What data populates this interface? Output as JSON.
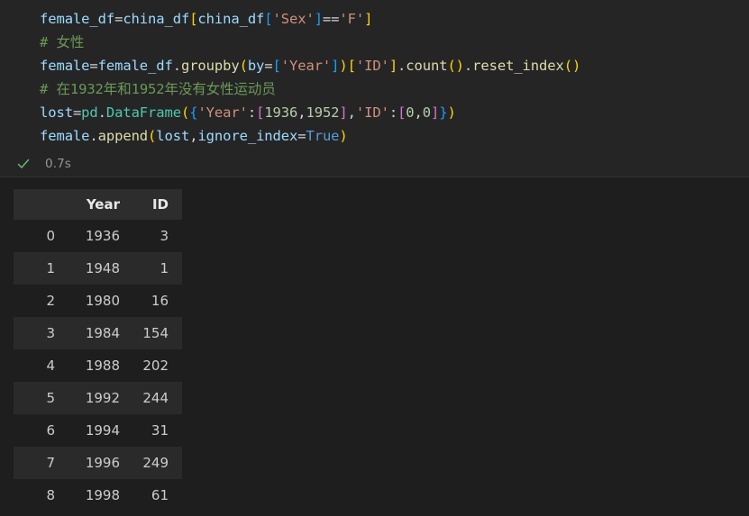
{
  "cell": {
    "status_icon": "check-icon",
    "status_accent": "#4EC9B0",
    "execution_time": "0.7s",
    "code_lines": [
      {
        "id": "line-1",
        "tokens": [
          {
            "t": "female_df",
            "c": "tok-var"
          },
          {
            "t": "=",
            "c": "tok-op"
          },
          {
            "t": "china_df",
            "c": "tok-var"
          },
          {
            "t": "[",
            "c": "tok-brk3"
          },
          {
            "t": "china_df",
            "c": "tok-var"
          },
          {
            "t": "[",
            "c": "tok-brk2"
          },
          {
            "t": "'Sex'",
            "c": "tok-str"
          },
          {
            "t": "]",
            "c": "tok-brk2"
          },
          {
            "t": "==",
            "c": "tok-op"
          },
          {
            "t": "'F'",
            "c": "tok-str"
          },
          {
            "t": "]",
            "c": "tok-brk3"
          }
        ]
      },
      {
        "id": "line-2",
        "tokens": [
          {
            "t": "# 女性",
            "c": "tok-cmt"
          }
        ]
      },
      {
        "id": "line-3",
        "tokens": [
          {
            "t": "female",
            "c": "tok-var"
          },
          {
            "t": "=",
            "c": "tok-op"
          },
          {
            "t": "female_df",
            "c": "tok-var"
          },
          {
            "t": ".",
            "c": "tok-punc"
          },
          {
            "t": "groupby",
            "c": "tok-fn"
          },
          {
            "t": "(",
            "c": "tok-brk3"
          },
          {
            "t": "by",
            "c": "tok-var"
          },
          {
            "t": "=",
            "c": "tok-op"
          },
          {
            "t": "[",
            "c": "tok-brk2"
          },
          {
            "t": "'Year'",
            "c": "tok-str"
          },
          {
            "t": "]",
            "c": "tok-brk2"
          },
          {
            "t": ")",
            "c": "tok-brk3"
          },
          {
            "t": "[",
            "c": "tok-brk3"
          },
          {
            "t": "'ID'",
            "c": "tok-str"
          },
          {
            "t": "]",
            "c": "tok-brk3"
          },
          {
            "t": ".",
            "c": "tok-punc"
          },
          {
            "t": "count",
            "c": "tok-fn"
          },
          {
            "t": "()",
            "c": "tok-brk3"
          },
          {
            "t": ".",
            "c": "tok-punc"
          },
          {
            "t": "reset_index",
            "c": "tok-fn"
          },
          {
            "t": "()",
            "c": "tok-brk3"
          }
        ]
      },
      {
        "id": "line-4",
        "tokens": [
          {
            "t": "# 在1932年和1952年没有女性运动员",
            "c": "tok-cmt"
          }
        ]
      },
      {
        "id": "line-5",
        "tokens": [
          {
            "t": "lost",
            "c": "tok-var"
          },
          {
            "t": "=",
            "c": "tok-op"
          },
          {
            "t": "pd",
            "c": "tok-cls"
          },
          {
            "t": ".",
            "c": "tok-punc"
          },
          {
            "t": "DataFrame",
            "c": "tok-cls"
          },
          {
            "t": "(",
            "c": "tok-brk3"
          },
          {
            "t": "{",
            "c": "tok-brk2"
          },
          {
            "t": "'Year'",
            "c": "tok-str"
          },
          {
            "t": ":",
            "c": "tok-punc"
          },
          {
            "t": "[",
            "c": "tok-brk"
          },
          {
            "t": "1936",
            "c": "tok-num"
          },
          {
            "t": ",",
            "c": "tok-punc"
          },
          {
            "t": "1952",
            "c": "tok-num"
          },
          {
            "t": "]",
            "c": "tok-brk"
          },
          {
            "t": ",",
            "c": "tok-punc"
          },
          {
            "t": "'ID'",
            "c": "tok-str"
          },
          {
            "t": ":",
            "c": "tok-punc"
          },
          {
            "t": "[",
            "c": "tok-brk"
          },
          {
            "t": "0",
            "c": "tok-num"
          },
          {
            "t": ",",
            "c": "tok-punc"
          },
          {
            "t": "0",
            "c": "tok-num"
          },
          {
            "t": "]",
            "c": "tok-brk"
          },
          {
            "t": "}",
            "c": "tok-brk2"
          },
          {
            "t": ")",
            "c": "tok-brk3"
          }
        ]
      },
      {
        "id": "line-6",
        "tokens": [
          {
            "t": "female",
            "c": "tok-var"
          },
          {
            "t": ".",
            "c": "tok-punc"
          },
          {
            "t": "append",
            "c": "tok-fn"
          },
          {
            "t": "(",
            "c": "tok-brk3"
          },
          {
            "t": "lost",
            "c": "tok-var"
          },
          {
            "t": ",",
            "c": "tok-punc"
          },
          {
            "t": "ignore_index",
            "c": "tok-var"
          },
          {
            "t": "=",
            "c": "tok-op"
          },
          {
            "t": "True",
            "c": "tok-kw"
          },
          {
            "t": ")",
            "c": "tok-brk3"
          }
        ]
      }
    ]
  },
  "output": {
    "table": {
      "columns": [
        "",
        "Year",
        "ID"
      ],
      "rows": [
        [
          "0",
          "1936",
          "3"
        ],
        [
          "1",
          "1948",
          "1"
        ],
        [
          "2",
          "1980",
          "16"
        ],
        [
          "3",
          "1984",
          "154"
        ],
        [
          "4",
          "1988",
          "202"
        ],
        [
          "5",
          "1992",
          "244"
        ],
        [
          "6",
          "1994",
          "31"
        ],
        [
          "7",
          "1996",
          "249"
        ],
        [
          "8",
          "1998",
          "61"
        ]
      ]
    }
  },
  "colors": {
    "editor_background": "#1e1e1e",
    "cell_background": "#252526",
    "header_row": "#2d2d2d",
    "stripe_row": "#2a2a2a",
    "text": "#cccccc",
    "success": "#4EC9B0",
    "muted": "#969696"
  }
}
